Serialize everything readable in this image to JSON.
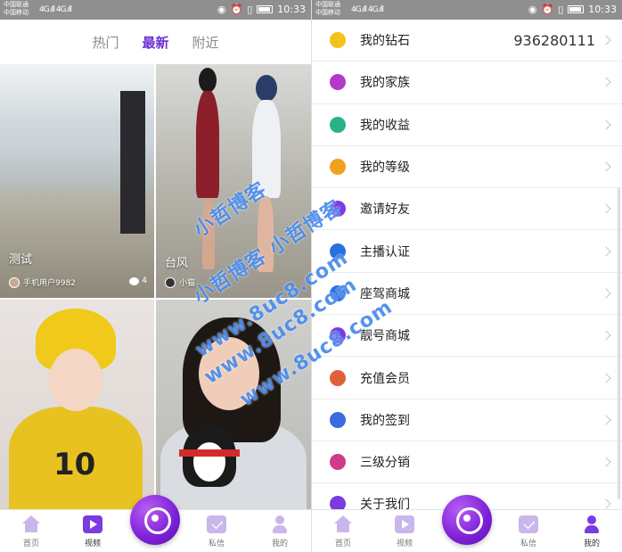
{
  "statusbar": {
    "carrier_1": "中国联通",
    "carrier_2": "中国移动",
    "signal": "4G.ıll 4G.ıll",
    "time": "10:33"
  },
  "tabs": [
    {
      "label": "热门",
      "active": false
    },
    {
      "label": "最新",
      "active": true
    },
    {
      "label": "附近",
      "active": false
    }
  ],
  "videos": [
    {
      "title": "测试",
      "user": "手机用户9982",
      "count": "4"
    },
    {
      "title": "台风",
      "user": "小猫",
      "count": ""
    },
    {
      "title": "",
      "user": "",
      "count": ""
    },
    {
      "title": "",
      "user": "",
      "count": ""
    }
  ],
  "bottom_nav_left": [
    {
      "label": "首页",
      "icon": "home-icon",
      "active": false
    },
    {
      "label": "视频",
      "icon": "video-icon",
      "active": true
    },
    {
      "label": "私信",
      "icon": "mail-icon",
      "active": false
    },
    {
      "label": "我的",
      "icon": "user-icon",
      "active": false
    }
  ],
  "bottom_nav_right": [
    {
      "label": "首页",
      "icon": "home-icon",
      "active": false
    },
    {
      "label": "视频",
      "icon": "video-icon",
      "active": false
    },
    {
      "label": "私信",
      "icon": "mail-icon",
      "active": false
    },
    {
      "label": "我的",
      "icon": "user-icon",
      "active": true
    }
  ],
  "menu": [
    {
      "label": "我的钻石",
      "value": "936280111",
      "icon": "diamond-icon",
      "color": "#f3c21b"
    },
    {
      "label": "我的家族",
      "value": "",
      "icon": "family-icon",
      "color": "#b03ac9"
    },
    {
      "label": "我的收益",
      "value": "",
      "icon": "income-icon",
      "color": "#27b28a"
    },
    {
      "label": "我的等级",
      "value": "",
      "icon": "level-icon",
      "color": "#f0a11f"
    },
    {
      "label": "邀请好友",
      "value": "",
      "icon": "invite-icon",
      "color": "#7a3be0"
    },
    {
      "label": "主播认证",
      "value": "",
      "icon": "certify-icon",
      "color": "#2a6fe0"
    },
    {
      "label": "座驾商城",
      "value": "",
      "icon": "car-icon",
      "color": "#2a6fe0"
    },
    {
      "label": "靓号商城",
      "value": "",
      "icon": "number-icon",
      "color": "#7a3be0"
    },
    {
      "label": "充值会员",
      "value": "",
      "icon": "vip-icon",
      "color": "#e0603a"
    },
    {
      "label": "我的签到",
      "value": "",
      "icon": "bell-icon",
      "color": "#3a6ae0"
    },
    {
      "label": "三级分销",
      "value": "",
      "icon": "distribution-icon",
      "color": "#d03a8a"
    },
    {
      "label": "关于我们",
      "value": "",
      "icon": "about-icon",
      "color": "#7a3be0"
    }
  ],
  "watermark": {
    "line1": "小哲博客",
    "line2": "小哲博客 小哲博客",
    "line3": "www.8uc8.com",
    "line4": "www.8uc8.com",
    "line5": "www.8uc8.com"
  },
  "colors": {
    "accent": "#7a3be0",
    "statusbar": "#8f8f8f"
  }
}
